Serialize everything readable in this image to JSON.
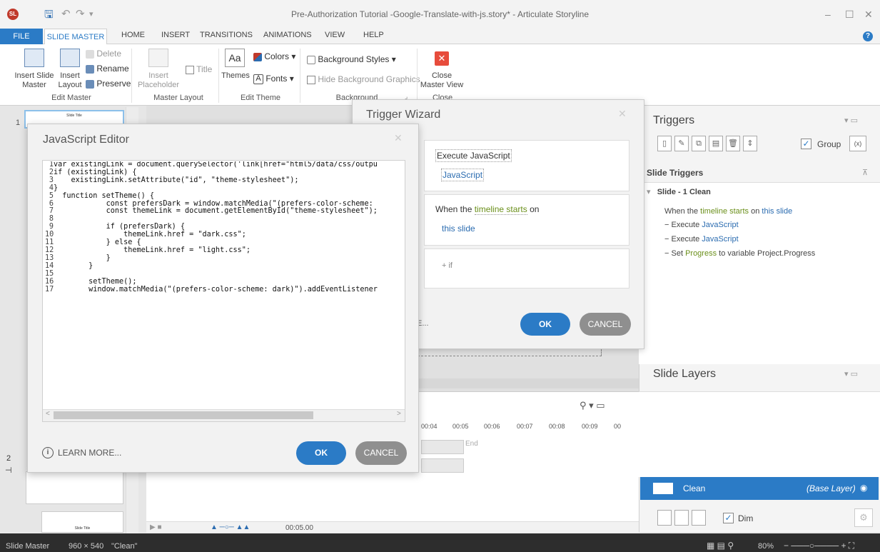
{
  "window": {
    "title": "Pre-Authorization Tutorial -Google-Translate-with-js.story* - Articulate Storyline",
    "app_badge": "SL",
    "minimize": "–",
    "maximize": "☐",
    "close": "✕"
  },
  "quick_access": {
    "save": "🖫",
    "undo": "↶",
    "redo": "↷",
    "more": "▾"
  },
  "ribbon_tabs": [
    "FILE",
    "SLIDE MASTER",
    "HOME",
    "INSERT",
    "TRANSITIONS",
    "ANIMATIONS",
    "VIEW",
    "HELP"
  ],
  "ribbon": {
    "insert_slide_master": "Insert Slide\nMaster",
    "insert_layout": "Insert\nLayout",
    "delete": "Delete",
    "rename": "Rename",
    "preserve": "Preserve",
    "edit_master_group": "Edit Master",
    "insert_placeholder": "Insert\nPlaceholder",
    "title": "Title",
    "master_layout_group": "Master Layout",
    "themes": "Themes",
    "colors": "Colors",
    "fonts": "Fonts",
    "edit_theme_group": "Edit Theme",
    "background_styles": "Background Styles",
    "hide_background_graphics": "Hide Background Graphics",
    "background_group": "Background",
    "close_master_view": "Close\nMaster View",
    "close_group": "Close",
    "themes_icon_text": "Aa",
    "fonts_icon_text": "A"
  },
  "slides": {
    "num1": "1",
    "num2": "2",
    "thumb1_title": "Slide Title",
    "thumb3_title": "Slide Title"
  },
  "timeline": {
    "ticks": [
      "00:04",
      "00:05",
      "00:06",
      "00:07",
      "00:08",
      "00:09",
      "00"
    ],
    "end_label": "End",
    "time": "00:05.00"
  },
  "triggers": {
    "title": "Triggers",
    "group_label": "Group",
    "var_btn": "(x)",
    "slide_triggers": "Slide Triggers",
    "slide_name": "Slide - 1 Clean",
    "when_prefix": "When the",
    "when_kw": "timeline starts",
    "when_mid": "on",
    "when_target": "this slide",
    "items": [
      {
        "prefix": "Execute",
        "kw": "JavaScript",
        "suffix": ""
      },
      {
        "prefix": "Execute",
        "kw": "JavaScript",
        "suffix": ""
      },
      {
        "prefix": "Set",
        "kw": "Progress",
        "suffix": "to variable Project.Progress"
      }
    ]
  },
  "layers": {
    "title": "Slide Layers",
    "clean_name": "Clean",
    "base_label": "(Base Layer)",
    "dim_label": "Dim"
  },
  "status": {
    "master": "Slide Master",
    "size": "960 × 540",
    "name": "\"Clean\"",
    "zoom": "80%"
  },
  "trigger_wizard": {
    "title": "Trigger Wizard",
    "action": "Execute JavaScript",
    "script": "JavaScript",
    "when_prefix": "When the",
    "when_kw": "timeline starts",
    "when_suffix": "on",
    "target": "this slide",
    "if_label": "+ if",
    "learn_partial": "E...",
    "ok": "OK",
    "cancel": "CANCEL"
  },
  "js_editor": {
    "title": "JavaScript Editor",
    "lines": [
      "var existingLink = document.querySelector('link[href=\"html5/data/css/outpu",
      "if (existingLink) {",
      "    existingLink.setAttribute(\"id\", \"theme-stylesheet\");",
      "}",
      "  function setTheme() {",
      "            const prefersDark = window.matchMedia(\"(prefers-color-scheme:",
      "            const themeLink = document.getElementById(\"theme-stylesheet\");",
      "",
      "            if (prefersDark) {",
      "                themeLink.href = \"dark.css\";",
      "            } else {",
      "                themeLink.href = \"light.css\";",
      "            }",
      "        }",
      "",
      "        setTheme();",
      "        window.matchMedia(\"(prefers-color-scheme: dark)\").addEventListener"
    ],
    "learn_more": "LEARN MORE...",
    "ok": "OK",
    "cancel": "CANCEL"
  }
}
